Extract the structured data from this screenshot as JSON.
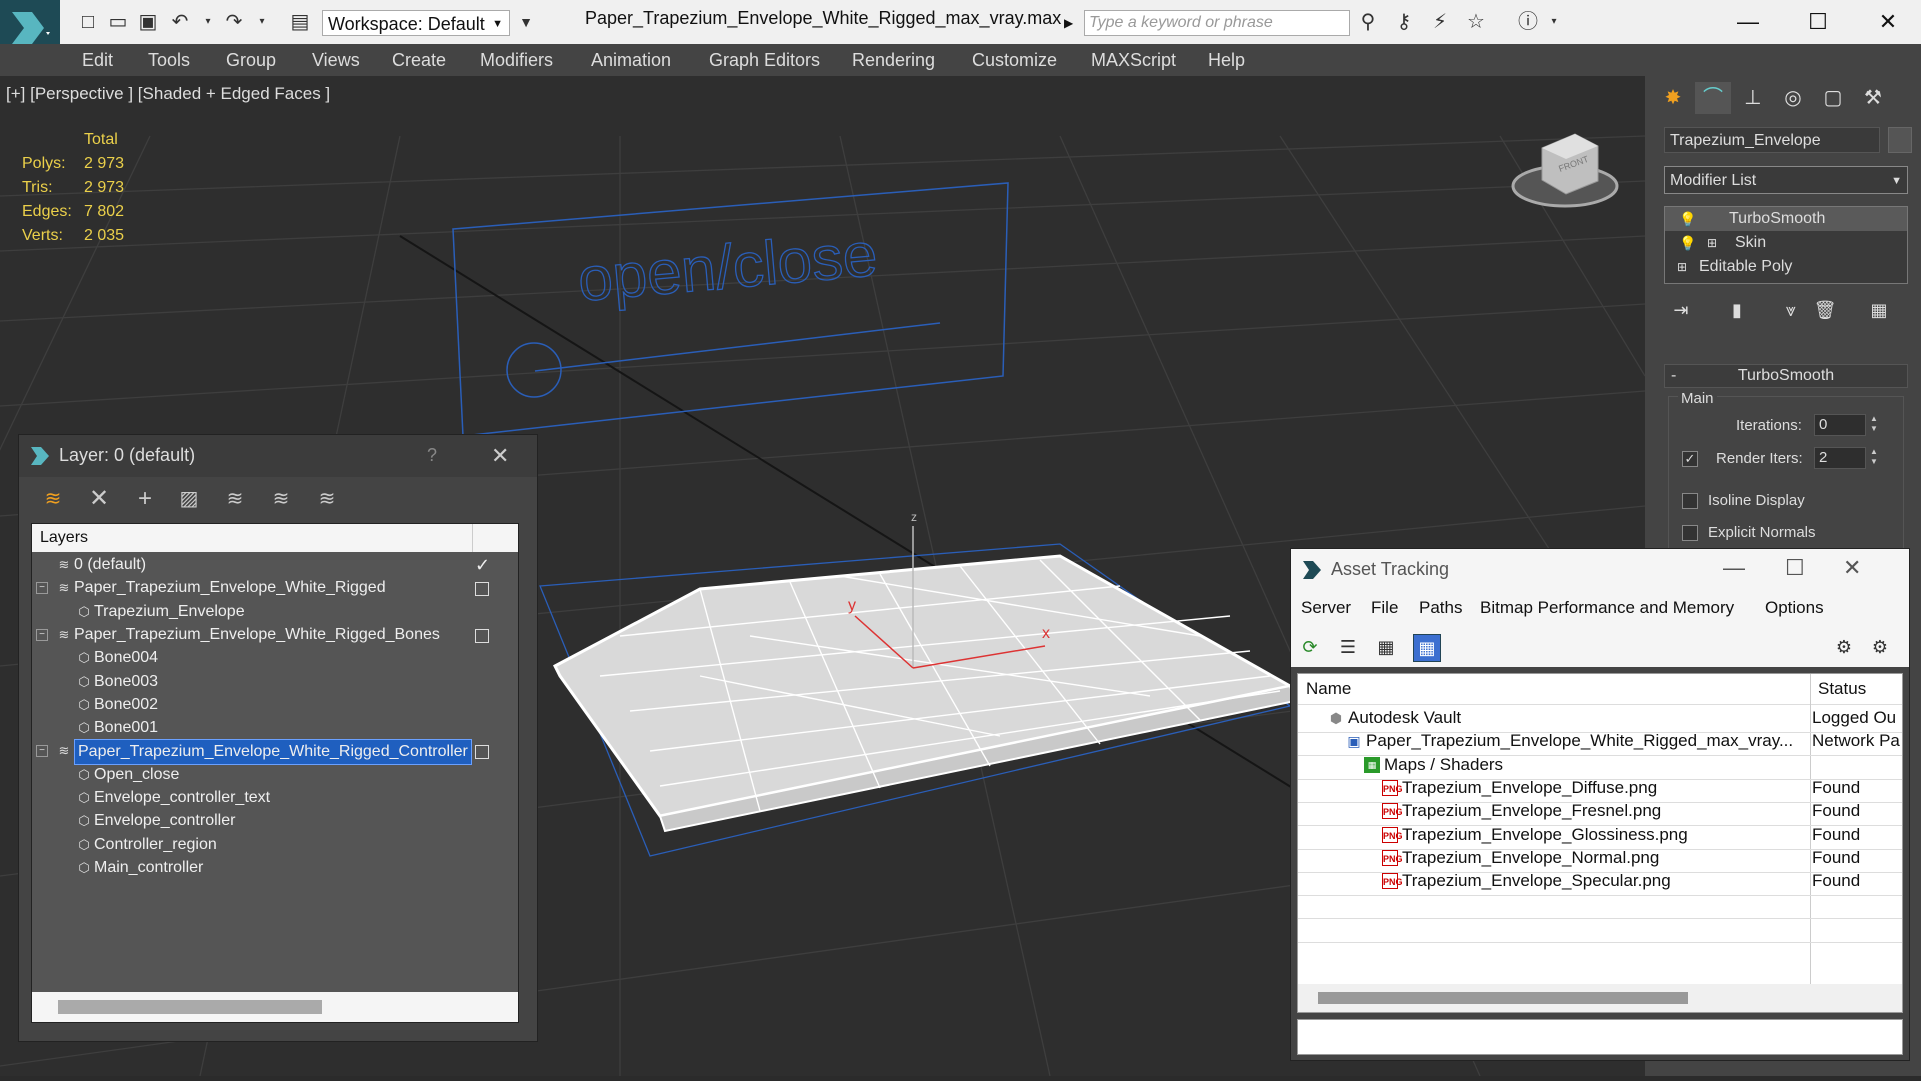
{
  "app": {
    "file_title": "Paper_Trapezium_Envelope_White_Rigged_max_vray.max",
    "workspace": "Workspace: Default",
    "search_placeholder": "Type a keyword or phrase"
  },
  "menu": [
    "Edit",
    "Tools",
    "Group",
    "Views",
    "Create",
    "Modifiers",
    "Animation",
    "Graph Editors",
    "Rendering",
    "Customize",
    "MAXScript",
    "Help"
  ],
  "viewport": {
    "label": "[+] [Perspective ] [Shaded + Edged Faces ]",
    "scene_text": "open/close",
    "stats": {
      "header": "Total",
      "rows": [
        {
          "k": "Polys:",
          "v": "2 973"
        },
        {
          "k": "Tris:",
          "v": "2 973"
        },
        {
          "k": "Edges:",
          "v": "7 802"
        },
        {
          "k": "Verts:",
          "v": "2 035"
        }
      ]
    },
    "axes": {
      "x": "x",
      "y": "y",
      "z": "z"
    },
    "viewcube_label": "FRONT"
  },
  "command_panel": {
    "object_name": "Trapezium_Envelope",
    "modifier_list": "Modifier List",
    "stack": [
      "TurboSmooth",
      "Skin",
      "Editable Poly"
    ],
    "turbosmooth": {
      "title": "TurboSmooth",
      "collapse": "-",
      "group": "Main",
      "iterations_label": "Iterations:",
      "iterations": "0",
      "render_iters_label": "Render Iters:",
      "render_iters": "2",
      "isoline": "Isoline Display",
      "explicit": "Explicit Normals"
    }
  },
  "layer_dialog": {
    "title": "Layer: 0 (default)",
    "help": "?",
    "column": "Layers",
    "rows": [
      {
        "name": "0 (default)",
        "level": 0,
        "type": "layer",
        "expander": "",
        "check": true
      },
      {
        "name": "Paper_Trapezium_Envelope_White_Rigged",
        "level": 0,
        "type": "layer",
        "expander": "−",
        "box": true
      },
      {
        "name": "Trapezium_Envelope",
        "level": 1,
        "type": "object"
      },
      {
        "name": "Paper_Trapezium_Envelope_White_Rigged_Bones",
        "level": 0,
        "type": "layer",
        "expander": "−",
        "box": true
      },
      {
        "name": "Bone004",
        "level": 1,
        "type": "object"
      },
      {
        "name": "Bone003",
        "level": 1,
        "type": "object"
      },
      {
        "name": "Bone002",
        "level": 1,
        "type": "object"
      },
      {
        "name": "Bone001",
        "level": 1,
        "type": "object"
      },
      {
        "name": "Paper_Trapezium_Envelope_White_Rigged_Controller",
        "level": 0,
        "type": "layer",
        "expander": "−",
        "box": true,
        "selected": true
      },
      {
        "name": "Open_close",
        "level": 1,
        "type": "object"
      },
      {
        "name": "Envelope_controller_text",
        "level": 1,
        "type": "object"
      },
      {
        "name": "Envelope_controller",
        "level": 1,
        "type": "object"
      },
      {
        "name": "Controller_region",
        "level": 1,
        "type": "object"
      },
      {
        "name": "Main_controller",
        "level": 1,
        "type": "object"
      }
    ]
  },
  "asset_dialog": {
    "title": "Asset Tracking",
    "menu": [
      "Server",
      "File",
      "Paths",
      "Bitmap Performance and Memory",
      "Options"
    ],
    "col_name": "Name",
    "col_status": "Status",
    "rows": [
      {
        "name": "Autodesk Vault",
        "status": "Logged Ou",
        "indent": 1,
        "icon": "vault"
      },
      {
        "name": "Paper_Trapezium_Envelope_White_Rigged_max_vray...",
        "status": "Network Pa",
        "indent": 2,
        "icon": "max"
      },
      {
        "name": "Maps / Shaders",
        "status": "",
        "indent": 3,
        "icon": "maps"
      },
      {
        "name": "Trapezium_Envelope_Diffuse.png",
        "status": "Found",
        "indent": 4,
        "icon": "png"
      },
      {
        "name": "Trapezium_Envelope_Fresnel.png",
        "status": "Found",
        "indent": 4,
        "icon": "png"
      },
      {
        "name": "Trapezium_Envelope_Glossiness.png",
        "status": "Found",
        "indent": 4,
        "icon": "png"
      },
      {
        "name": "Trapezium_Envelope_Normal.png",
        "status": "Found",
        "indent": 4,
        "icon": "png"
      },
      {
        "name": "Trapezium_Envelope_Specular.png",
        "status": "Found",
        "indent": 4,
        "icon": "png"
      }
    ],
    "png_badge": "PNG"
  },
  "colors": {
    "accent_blue": "#2a5eb8",
    "stats_yellow": "#ebd04a",
    "selected_row": "#1f5fbf"
  }
}
